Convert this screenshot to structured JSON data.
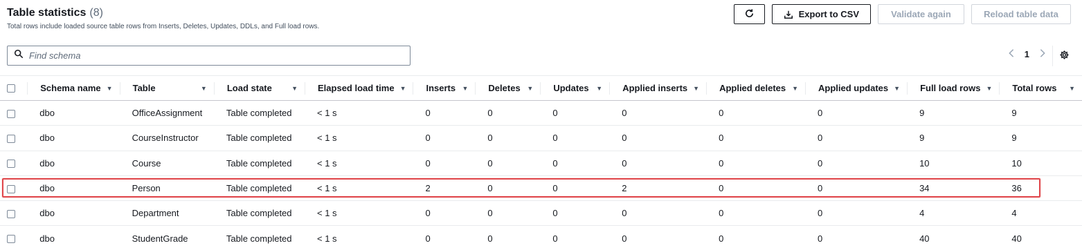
{
  "header": {
    "title": "Table statistics",
    "count": "(8)",
    "subtitle": "Total rows include loaded source table rows from Inserts, Deletes, Updates, DDLs, and Full load rows."
  },
  "actions": {
    "refresh_icon": "refresh-icon",
    "export_label": "Export to CSV",
    "export_icon": "download-icon",
    "validate_label": "Validate again",
    "reload_label": "Reload table data"
  },
  "search": {
    "placeholder": "Find schema",
    "value": ""
  },
  "pagination": {
    "current_page": "1"
  },
  "columns": [
    "Schema name",
    "Table",
    "Load state",
    "Elapsed load time",
    "Inserts",
    "Deletes",
    "Updates",
    "Applied inserts",
    "Applied deletes",
    "Applied updates",
    "Full load rows",
    "Total rows"
  ],
  "rows": [
    [
      "dbo",
      "OfficeAssignment",
      "Table completed",
      "< 1 s",
      "0",
      "0",
      "0",
      "0",
      "0",
      "0",
      "9",
      "9"
    ],
    [
      "dbo",
      "CourseInstructor",
      "Table completed",
      "< 1 s",
      "0",
      "0",
      "0",
      "0",
      "0",
      "0",
      "9",
      "9"
    ],
    [
      "dbo",
      "Course",
      "Table completed",
      "< 1 s",
      "0",
      "0",
      "0",
      "0",
      "0",
      "0",
      "10",
      "10"
    ],
    [
      "dbo",
      "Person",
      "Table completed",
      "< 1 s",
      "2",
      "0",
      "0",
      "2",
      "0",
      "0",
      "34",
      "36"
    ],
    [
      "dbo",
      "Department",
      "Table completed",
      "< 1 s",
      "0",
      "0",
      "0",
      "0",
      "0",
      "0",
      "4",
      "4"
    ],
    [
      "dbo",
      "StudentGrade",
      "Table completed",
      "< 1 s",
      "0",
      "0",
      "0",
      "0",
      "0",
      "0",
      "40",
      "40"
    ]
  ],
  "colors": {
    "highlight": "#e0474c",
    "text": "#16191f",
    "muted": "#5f6b7a",
    "disabled": "#9ba7b6"
  }
}
